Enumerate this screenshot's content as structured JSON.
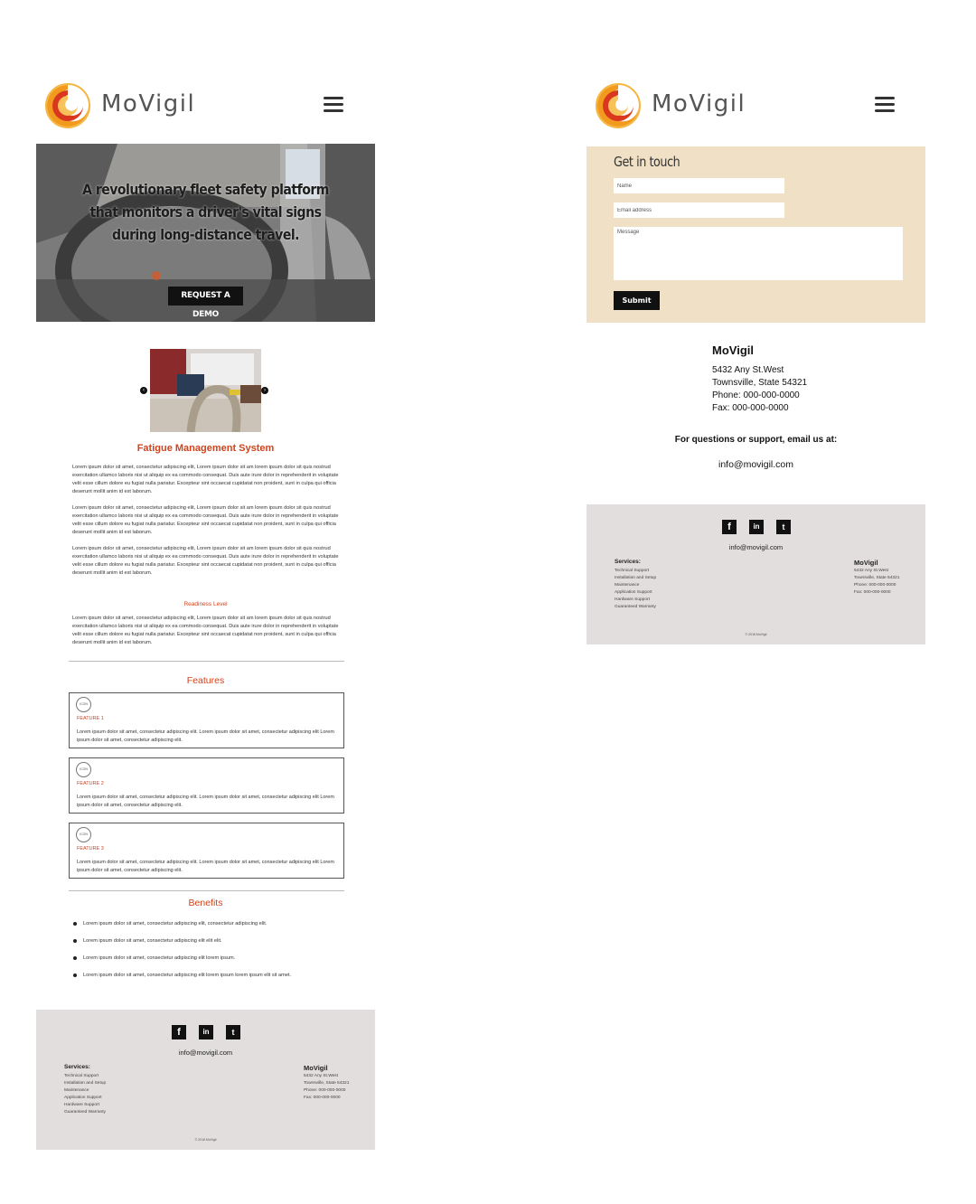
{
  "brand": {
    "name": "MoVigil",
    "logo_icon": "movigil-swirl-logo",
    "colors": {
      "accent": "#d0431c",
      "logo_orange": "#f29a1e",
      "logo_red": "#d9381e",
      "footer_bg": "#e1dedd",
      "contact_bg": "#f0e0c5"
    }
  },
  "header": {
    "menu_icon": "hamburger-menu-icon"
  },
  "hero": {
    "headline": "A revolutionary fleet safety platform that monitors a driver's vital signs during long-distance travel.",
    "cta_label": "REQUEST A DEMO"
  },
  "carousel": {
    "prev_icon": "‹",
    "next_icon": "›"
  },
  "fatigue": {
    "title": "Fatigue Management System",
    "paragraphs": [
      "Lorem ipsum dolor sit amet, consectetur adipiscing elit, Lorem ipsum dolor sit am lorem ipsum dolor sit quis nostrud exercitation ullamco laboris nisi ut aliquip ex ea commodo consequat. Duis aute irure dolor in reprehenderit in voluptate velit esse cillum dolore eu fugiat nulla pariatur. Excepteur sint occaecat cupidatat non proident, sunt in culpa qui officia deserunt mollit anim id est laborum.",
      "Lorem ipsum dolor sit amet, consectetur adipiscing elit, Lorem ipsum dolor sit am lorem ipsum dolor sit quis nostrud exercitation ullamco laboris nisi ut aliquip ex ea commodo consequat. Duis aute irure dolor in reprehenderit in voluptate velit esse cillum dolore eu fugiat nulla pariatur. Excepteur sint occaecat cupidatat non proident, sunt in culpa qui officia deserunt mollit anim id est laborum.",
      "Lorem ipsum dolor sit amet, consectetur adipiscing elit, Lorem ipsum dolor sit am lorem ipsum dolor sit quis nostrud exercitation ullamco laboris nisi ut aliquip ex ea commodo consequat. Duis aute irure dolor in reprehenderit in voluptate velit esse cillum dolore eu fugiat nulla pariatur. Excepteur sint occaecat cupidatat non proident, sunt in culpa qui officia deserunt mollit anim id est laborum."
    ]
  },
  "readiness": {
    "title": "Readiness Level",
    "paragraph": "Lorem ipsum dolor sit amet, consectetur adipiscing elit, Lorem ipsum dolor sit am lorem ipsum dolor sit quis nostrud exercitation ullamco laboris nisi ut aliquip ex ea commodo consequat. Duis aute irure dolor in reprehenderit in voluptate velit esse cillum dolore eu fugiat nulla pariatur. Excepteur sint occaecat cupidatat non proident, sunt in culpa qui officia deserunt mollit anim id est laborum."
  },
  "features": {
    "title": "Features",
    "items": [
      {
        "icon_label": "ICON",
        "title": "FEATURE 1",
        "text": "Lorem ipsum dolor sit amet, consectetur adipiscing elit. Lorem ipsum dolor sit amet, consectetur adipiscing elit Lorem ipsum dolor sit amet, consectetur adipiscing elit."
      },
      {
        "icon_label": "ICON",
        "title": "FEATURE 2",
        "text": "Lorem ipsum dolor sit amet, consectetur adipiscing elit. Lorem ipsum dolor sit amet, consectetur adipiscing elit Lorem ipsum dolor sit amet, consectetur adipiscing elit."
      },
      {
        "icon_label": "ICON",
        "title": "FEATURE 3",
        "text": "Lorem ipsum dolor sit amet, consectetur adipiscing elit. Lorem ipsum dolor sit amet, consectetur adipiscing elit Lorem ipsum dolor sit amet, consectetur adipiscing elit."
      }
    ]
  },
  "benefits": {
    "title": "Benefits",
    "items": [
      "Lorem ipsum dolor sit amet, consectetur adipiscing elit, consectetur adipiscing elit.",
      "Lorem ipsum dolor sit amet, consectetur adipiscing elit elit elit.",
      "Lorem ipsum dolor sit amet, consectetur adipiscing elit lorem ipsum.",
      "Lorem ipsum dolor sit amet, consectetur adipiscing elit lorem ipsum lorem ipsum elit sit amet."
    ]
  },
  "footer": {
    "social": [
      {
        "name": "facebook-icon",
        "glyph": "f"
      },
      {
        "name": "linkedin-icon",
        "glyph": "in"
      },
      {
        "name": "twitter-icon",
        "glyph": "t"
      }
    ],
    "email": "info@movigil.com",
    "services_title": "Services:",
    "services": [
      "Technical Support",
      "Installation and Setup",
      "Maintenance",
      "Application Support",
      "Hardware Support",
      "Guaranteed Warranty"
    ],
    "company": "MoVigil",
    "address_lines": [
      "5432 Any St.West",
      "Townsville, State 54321",
      "Phone: 000-000-0000",
      "Fax: 000-000-0000"
    ],
    "copyright": "© 2018 MoVigil"
  },
  "contact": {
    "title": "Get in touch",
    "name_placeholder": "Name",
    "email_placeholder": "Email address",
    "message_placeholder": "Message",
    "submit_label": "Submit"
  },
  "address": {
    "name": "MoVigil",
    "lines": [
      "5432 Any St.West",
      "Townsville, State 54321",
      "Phone: 000-000-0000",
      "Fax: 000-000-0000"
    ]
  },
  "support": {
    "text": "For questions or support, email us at:",
    "email": "info@movigil.com"
  }
}
